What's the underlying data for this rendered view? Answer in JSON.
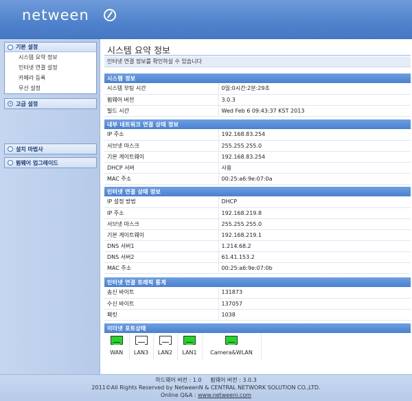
{
  "header": {
    "logo": "netween"
  },
  "sidebar": {
    "basic_title": "기본 설정",
    "basic_items": [
      "시스템 요약 정보",
      "인터넷 연결 설정",
      "카메라 등록",
      "무선 설정"
    ],
    "advanced_title": "고급 설정",
    "wizard_title": "설치 마법사",
    "firmware_title": "펌웨어 업그레이드"
  },
  "main": {
    "title": "시스템 요약 정보",
    "description": "인터넷 연결 정보를 확인하실 수 있습니다",
    "sections": [
      {
        "header": "시스템 정보",
        "rows": [
          [
            "시스템 부팅 시간",
            "0일:0시간:2분:29초"
          ],
          [
            "펌웨어 버전",
            "3.0.3"
          ],
          [
            "빌드 시간",
            "Wed Feb 6 09:43:37 KST 2013"
          ]
        ]
      },
      {
        "header": "내부 네트워크 연결 상태 정보",
        "rows": [
          [
            "IP 주소",
            "192.168.83.254"
          ],
          [
            "서브넷 마스크",
            "255.255.255.0"
          ],
          [
            "기본 게이트웨이",
            "192.168.83.254"
          ],
          [
            "DHCP 서버",
            "사용"
          ],
          [
            "MAC 주소",
            "00:25:a6:9e:07:0a"
          ]
        ]
      },
      {
        "header": "인터넷 연결 상태 정보",
        "rows": [
          [
            "IP 설정 방법",
            "DHCP"
          ],
          [
            "IP 주소",
            "192.168.219.8"
          ],
          [
            "서브넷 마스크",
            "255.255.255.0"
          ],
          [
            "기본 게이트웨이",
            "192.168.219.1"
          ],
          [
            "DNS 서버1",
            "1.214.68.2"
          ],
          [
            "DNS 서버2",
            "61.41.153.2"
          ],
          [
            "MAC 주소",
            "00:25:a6:9e:07:0b"
          ]
        ]
      },
      {
        "header": "인터넷 연결 트래픽 통계",
        "rows": [
          [
            "송신 바이트",
            "131873"
          ],
          [
            "수신 바이트",
            "137057"
          ],
          [
            "패킷",
            "1038"
          ]
        ]
      }
    ],
    "ports_header": "이더넷 포트상태",
    "ports": [
      {
        "label": "WAN",
        "status": "up"
      },
      {
        "label": "LAN3",
        "status": "down"
      },
      {
        "label": "LAN2",
        "status": "down"
      },
      {
        "label": "LAN1",
        "status": "up"
      },
      {
        "label": "Camera&WLAN",
        "status": "up"
      }
    ]
  },
  "footer": {
    "versions": "하드웨어 버전 : 1.0     펌웨어 버전 : 3.0.3",
    "copyright": "2011©All Rights Reserved by NetweenN & CENTRAL NETWORK SOLUTION CO.,LTD.",
    "online_label": "Online Q&A : ",
    "online_link": "www.netweeni.com"
  },
  "colors": {
    "header_blue": "#4f82cc",
    "section_blue": "#4a80cf",
    "port_up": "#27d42b"
  }
}
